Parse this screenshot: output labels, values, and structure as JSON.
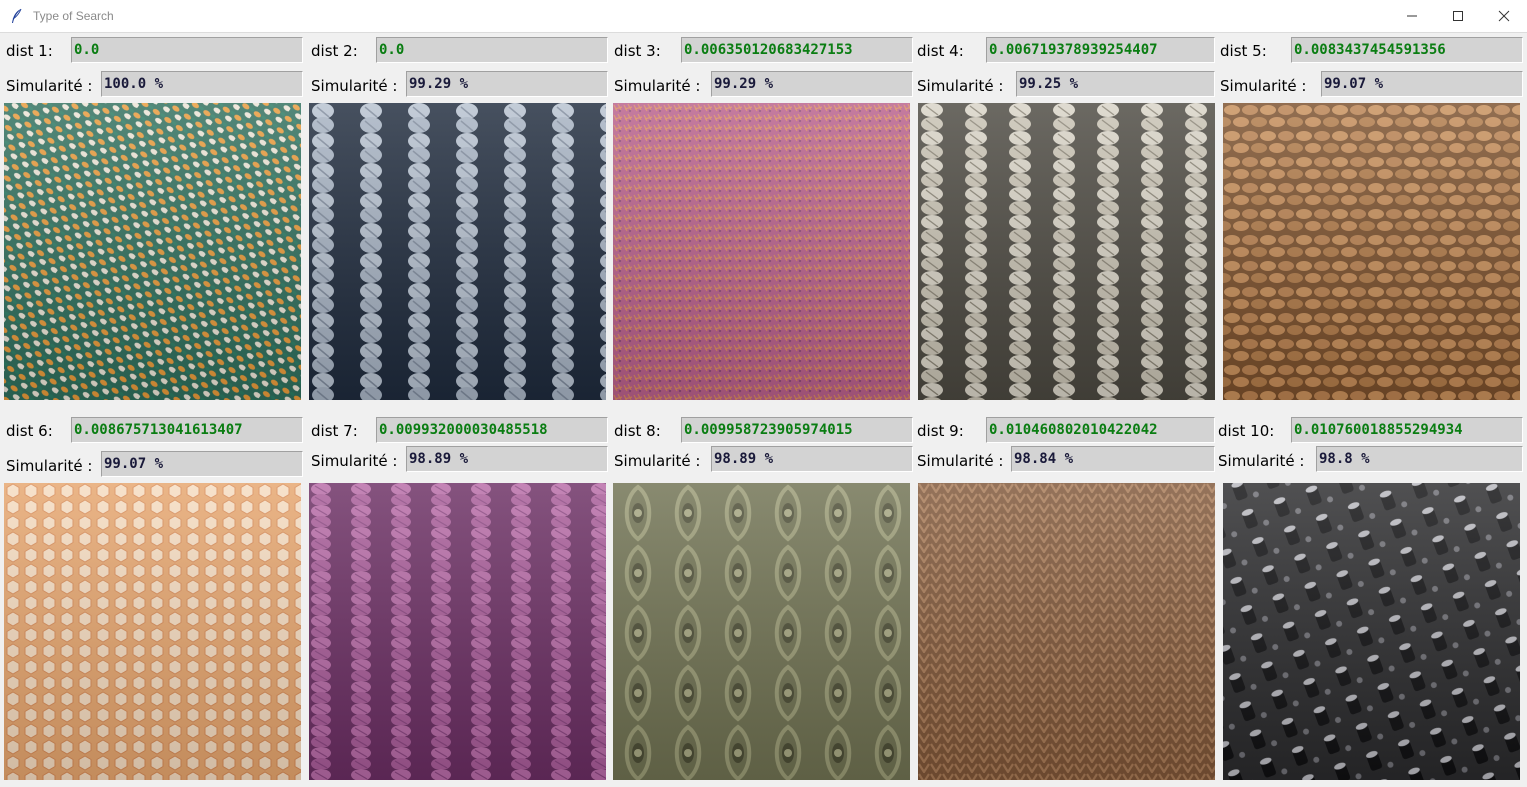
{
  "window": {
    "title": "Type of Search",
    "icon": "feather-icon",
    "controls": [
      "minimize-icon",
      "maximize-icon",
      "close-icon"
    ]
  },
  "results": [
    {
      "dist_label": "dist 1:",
      "dist": "0.0",
      "sim_label": "Simularité :",
      "sim": "100.0 %",
      "texture": "braided multicolor rope"
    },
    {
      "dist_label": "dist 2:",
      "dist": "0.0",
      "sim_label": "Simularité :",
      "sim": "99.29 %",
      "texture": "pale blue rib knit"
    },
    {
      "dist_label": "dist 3:",
      "dist": "0.006350120683427153",
      "sim_label": "Simularité :",
      "sim": "99.29 %",
      "texture": "pink orange mohair knit"
    },
    {
      "dist_label": "dist 4:",
      "dist": "0.006719378939254407",
      "sim_label": "Simularité :",
      "sim": "99.25 %",
      "texture": "grey white rib knit"
    },
    {
      "dist_label": "dist 5:",
      "dist": "0.0083437454591356",
      "sim_label": "Simularité :",
      "sim": "99.07 %",
      "texture": "woven jute"
    },
    {
      "dist_label": "dist 6:",
      "dist": "0.008675713041613407",
      "sim_label": "Simularité :",
      "sim": "99.07 %",
      "texture": "honeycomb"
    },
    {
      "dist_label": "dist 7:",
      "dist": "0.009932000030485518",
      "sim_label": "Simularité :",
      "sim": "98.89 %",
      "texture": "purple rib knit"
    },
    {
      "dist_label": "dist 8:",
      "dist": "0.009958723905974015",
      "sim_label": "Simularité :",
      "sim": "98.89 %",
      "texture": "olive lace knit"
    },
    {
      "dist_label": "dist 9:",
      "dist": "0.010460802010422042",
      "sim_label": "Simularité :",
      "sim": "98.84 %",
      "texture": "brown stockinette knit"
    },
    {
      "dist_label": "dist 10:",
      "dist": "0.010760018855294934",
      "sim_label": "Simularité :",
      "sim": "98.8 %",
      "texture": "black metal studs"
    }
  ],
  "colors": {
    "dist_text": "#0a7d12",
    "sim_text": "#1a1a3a",
    "entry_bg": "#d3d3d3",
    "window_bg": "#f0f0f0"
  }
}
